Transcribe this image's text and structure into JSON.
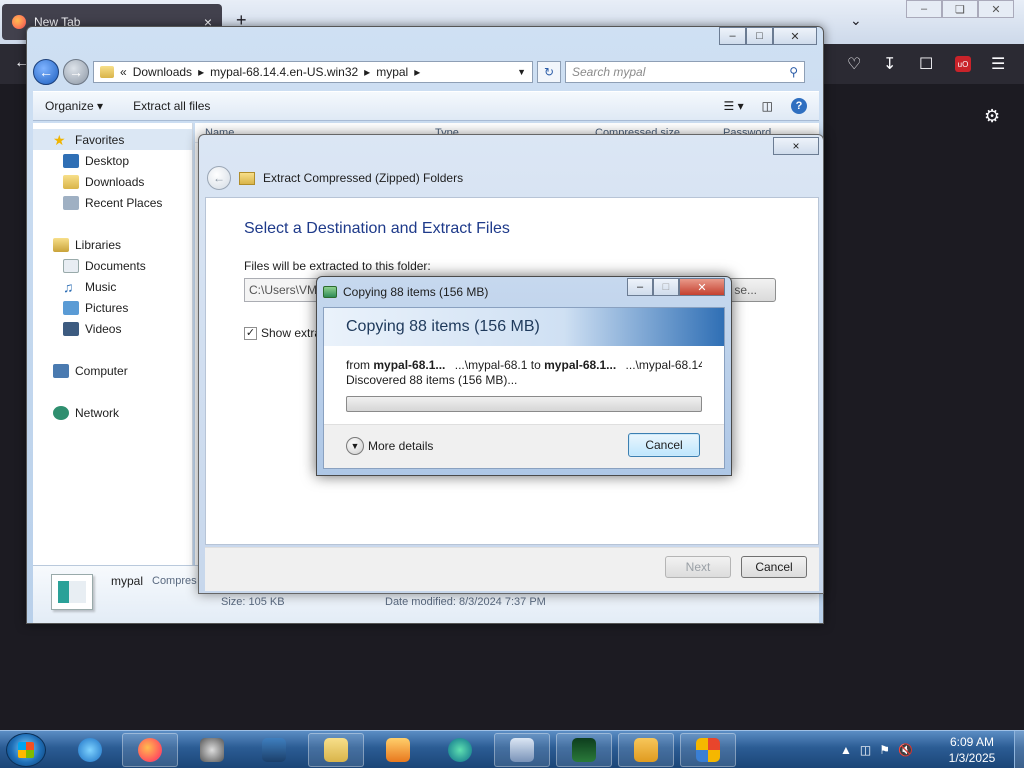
{
  "firefox": {
    "tab_title": "New Tab",
    "tab_close": "×",
    "new_tab": "+",
    "tabs_menu": "⌄"
  },
  "explorer": {
    "breadcrumb": [
      "«",
      "Downloads",
      "mypal-68.14.4.en-US.win32",
      "mypal"
    ],
    "search_placeholder": "Search mypal",
    "organize_label": "Organize",
    "extract_all_label": "Extract all files",
    "columns": [
      "Name",
      "Type",
      "Compressed size",
      "Password ..."
    ],
    "nav": {
      "favorites": "Favorites",
      "desktop": "Desktop",
      "downloads": "Downloads",
      "recent": "Recent Places",
      "libraries": "Libraries",
      "documents": "Documents",
      "music": "Music",
      "pictures": "Pictures",
      "videos": "Videos",
      "computer": "Computer",
      "network": "Network"
    },
    "details": {
      "name": "mypal",
      "type": "Compres",
      "size": "Size: 105 KB",
      "date": "Date modified: 8/3/2024 7:37 PM"
    }
  },
  "wizard": {
    "close": "×",
    "header": "Extract Compressed (Zipped) Folders",
    "title": "Select a Destination and Extract Files",
    "dest_label": "Files will be extracted to this folder:",
    "dest_value": "C:\\Users\\VM",
    "browse_label": "se...",
    "show_label": "Show extra",
    "next_label": "Next",
    "cancel_label": "Cancel"
  },
  "copy_dialog": {
    "window_title": "Copying 88 items (156 MB)",
    "banner_title": "Copying 88 items (156 MB)",
    "from_prefix": "from",
    "from_name": "mypal-68.1...",
    "from_path": "...\\mypal-68.1",
    "to_word": "to",
    "to_name": "mypal-68.1...",
    "to_path": "...\\mypal-68.14",
    "discovered": "Discovered 88 items (156 MB)...",
    "progress": 0.0,
    "more_details": "More details",
    "cancel_label": "Cancel"
  },
  "taskbar": {
    "apps": [
      "internet-explorer",
      "firefox",
      "raccoon",
      "virtualbox",
      "file-explorer",
      "media-player",
      "edge",
      "win7-app",
      "task-manager",
      "infinity-app",
      "office-app"
    ],
    "time": "6:09 AM",
    "date": "1/3/2025"
  },
  "colors": {
    "accent_blue": "#1e3a8a",
    "taskbar": "#2b5c94",
    "firefox_dark": "#1c1b22"
  }
}
